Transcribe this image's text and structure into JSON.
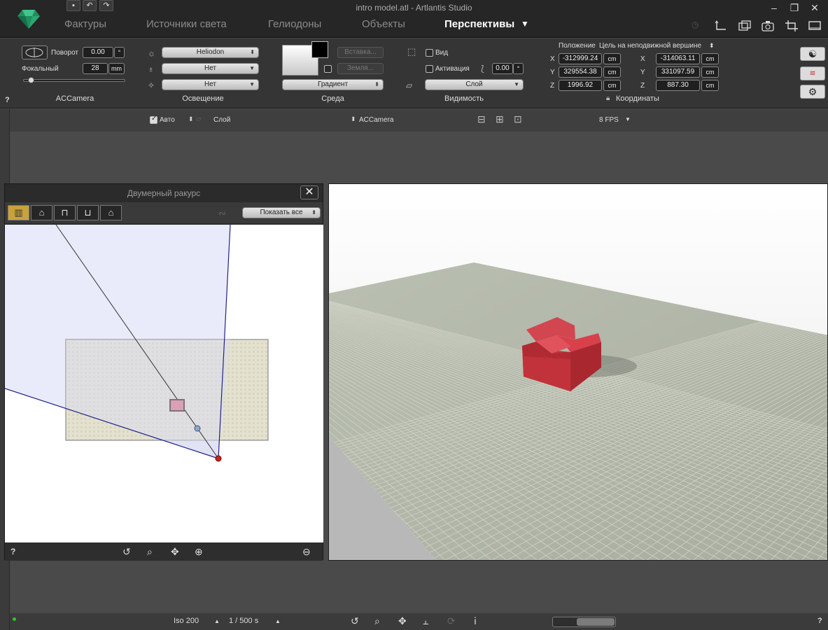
{
  "window": {
    "title": "intro model.atl - Artlantis Studio"
  },
  "tabs": [
    {
      "label": "Фактуры"
    },
    {
      "label": "Источники света"
    },
    {
      "label": "Гелиодоны"
    },
    {
      "label": "Объекты"
    },
    {
      "label": "Перспективы",
      "active": true
    }
  ],
  "camera": {
    "rotation_label": "Поворот",
    "rotation_value": "0.00",
    "rotation_unit": "°",
    "focal_label": "Фокальный",
    "focal_value": "28",
    "focal_unit": "mm",
    "name": "ACCamera"
  },
  "lighting": {
    "section": "Освещение",
    "heliodon": "Heliodon",
    "light1": "Нет",
    "light2": "Нет"
  },
  "environment": {
    "section": "Среда",
    "insert_button": "Вставка...",
    "ground_button": "Земля...",
    "background": "Градиент"
  },
  "visibility": {
    "section": "Видимость",
    "view_label": "Вид",
    "activation_label": "Активация",
    "activation_value": "0.00",
    "activation_unit": "°",
    "layer": "Слой"
  },
  "coordinates": {
    "section": "Координаты",
    "position_label": "Положение",
    "target_label": "Цель на неподвижной вершине",
    "position": {
      "x": "-312999.24",
      "y": "329554.38",
      "z": "1996.92"
    },
    "target": {
      "x": "-314063.11",
      "y": "331097.59",
      "z": "887.30"
    },
    "unit": "cm",
    "axis_x": "X",
    "axis_y": "Y",
    "axis_z": "Z"
  },
  "help": "?",
  "subbar": {
    "auto_label": "Авто",
    "layer_label": "Слой",
    "camera": "ACCamera",
    "fps": "8 FPS"
  },
  "view2d": {
    "title": "Двумерный ракурс",
    "show_all": "Показать все",
    "help": "?"
  },
  "bottombar": {
    "iso": "Iso 200",
    "shutter": "1 / 500 s",
    "help": "?"
  },
  "colors": {
    "accent_gold": "#c9a23b",
    "camera_red": "#cc2222",
    "armchair_red": "#c8323a"
  }
}
